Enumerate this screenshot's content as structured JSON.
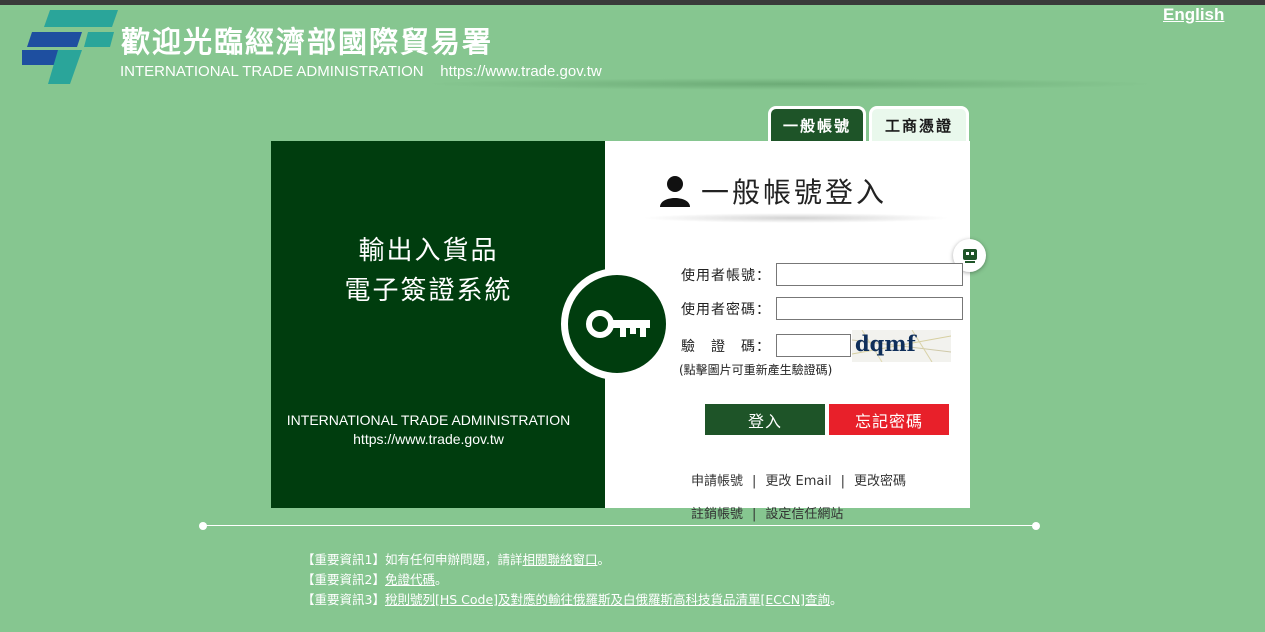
{
  "header": {
    "title": "歡迎光臨經濟部國際貿易署",
    "subtitle": "INTERNATIONAL TRADE ADMINISTRATION    https://www.trade.gov.tw",
    "lang_link": "English",
    "logo_icon": "ita-logo-icon"
  },
  "tabs": [
    {
      "label": "一般帳號",
      "active": true
    },
    {
      "label": "工商憑證",
      "active": false
    }
  ],
  "left_panel": {
    "title_line1": "輸出入貨品",
    "title_line2": "電子簽證系統",
    "org_name": "INTERNATIONAL TRADE ADMINISTRATION",
    "org_url": "https://www.trade.gov.tw",
    "icon": "key-icon"
  },
  "login": {
    "heading": "一般帳號登入",
    "heading_icon": "user-icon",
    "username_label": "使用者帳號：",
    "username_value": "",
    "password_label": "使用者密碼：",
    "password_value": "",
    "captcha_label": "驗　證　碼：",
    "captcha_value": "",
    "captcha_text": "dqmf",
    "captcha_hint": "(點擊圖片可重新產生驗證碼)",
    "login_button": "登入",
    "forgot_button": "忘記密碼",
    "chat_icon": "chat-robot-icon"
  },
  "links_row1": [
    "申請帳號",
    "更改 Email",
    "更改密碼"
  ],
  "links_row2": [
    "註銷帳號",
    "設定信任網站"
  ],
  "notices": [
    {
      "prefix": "【重要資訊1】如有任何申辦問題，請詳",
      "link": "相關聯絡窗口",
      "suffix": "。"
    },
    {
      "prefix": "【重要資訊2】",
      "link": "免證代碼",
      "suffix": "。"
    },
    {
      "prefix": "【重要資訊3】",
      "link": "稅則號列[HS Code]及對應的輸往俄羅斯及白俄羅斯高科技貨品清單[ECCN]查詢",
      "suffix": "。"
    }
  ],
  "colors": {
    "background": "#86c690",
    "dark_green": "#003d0e",
    "button_green": "#1e5428",
    "button_red": "#e8202a",
    "logo_blue": "#1e4fa0",
    "logo_teal": "#2aa59a"
  }
}
